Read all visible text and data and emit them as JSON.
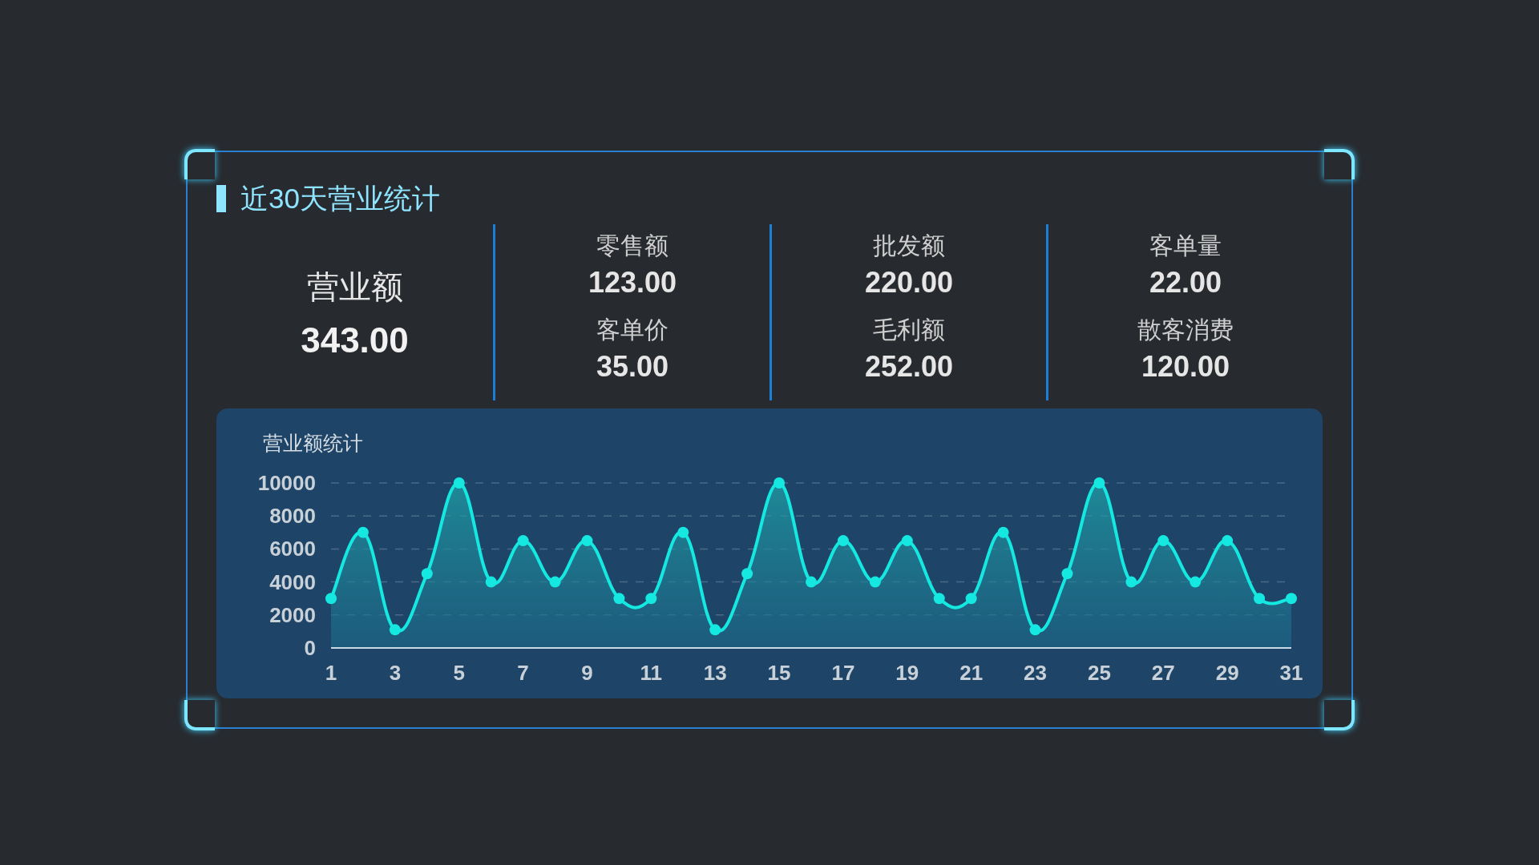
{
  "panel": {
    "title": "近30天营业统计",
    "main_stat": {
      "label": "营业额",
      "value": "343.00"
    },
    "stat_columns": [
      [
        {
          "label": "零售额",
          "value": "123.00"
        },
        {
          "label": "客单价",
          "value": "35.00"
        }
      ],
      [
        {
          "label": "批发额",
          "value": "220.00"
        },
        {
          "label": "毛利额",
          "value": "252.00"
        }
      ],
      [
        {
          "label": "客单量",
          "value": "22.00"
        },
        {
          "label": "散客消费",
          "value": "120.00"
        }
      ]
    ],
    "chart_data": {
      "type": "area",
      "title": "营业额统计",
      "x": [
        1,
        2,
        3,
        4,
        5,
        6,
        7,
        8,
        9,
        10,
        11,
        12,
        13,
        14,
        15,
        16,
        17,
        18,
        19,
        20,
        21,
        22,
        23,
        24,
        25,
        26,
        27,
        28,
        29,
        30,
        31
      ],
      "series": [
        {
          "color": "#14e8e0",
          "values": [
            3000,
            7000,
            1100,
            4500,
            10000,
            4000,
            6500,
            4000,
            6500,
            3000,
            3000,
            7000,
            1100,
            4500,
            10000,
            4000,
            6500,
            4000,
            6500,
            3000,
            3000,
            7000,
            1100,
            4500,
            10000,
            4000,
            6500,
            4000,
            6500,
            3000,
            3000
          ]
        }
      ],
      "xlim": [
        1,
        31
      ],
      "grid": true,
      "ylim": [
        0,
        10000
      ],
      "yticks": [
        0,
        2000,
        4000,
        6000,
        8000,
        10000
      ],
      "xticks": [
        1,
        3,
        5,
        7,
        9,
        11,
        13,
        15,
        17,
        19,
        21,
        23,
        25,
        27,
        29,
        31
      ]
    }
  }
}
